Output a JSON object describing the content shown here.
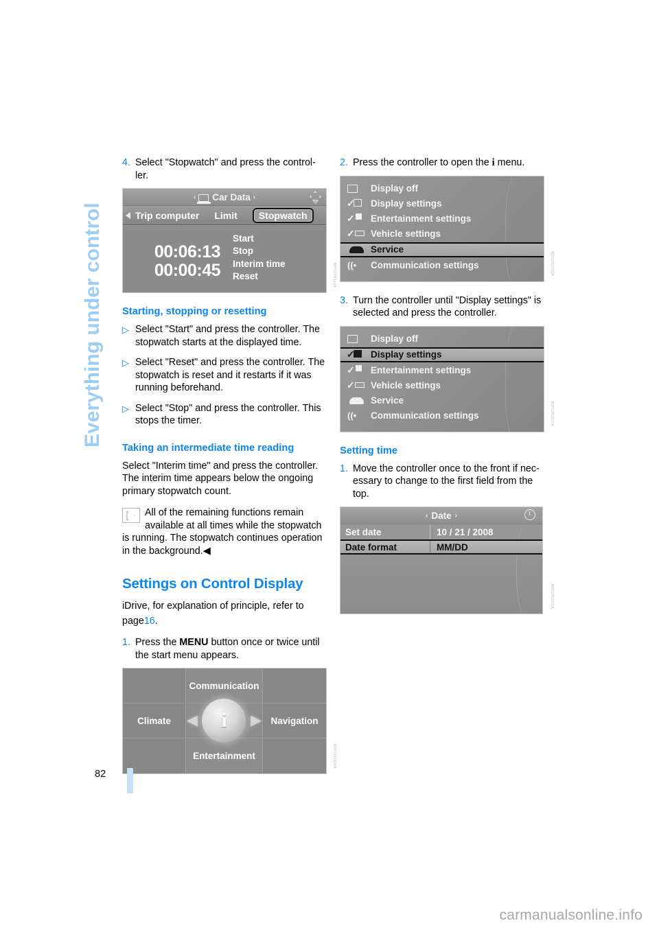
{
  "chapter_title": "Everything under control",
  "page_number": "82",
  "watermark": "carmanualsonline.info",
  "left_column": {
    "step4": {
      "num": "4.",
      "text": "Select \"Stopwatch\" and press the control-ler."
    },
    "stopwatch_screen": {
      "title": "Car Data",
      "arrow_left": "‹",
      "arrow_right": "›",
      "tabs": [
        "Trip computer",
        "Limit",
        "Stopwatch"
      ],
      "selected_tab": "Stopwatch",
      "primary_time": "00:06:13",
      "interim_time": "00:00:45",
      "actions": [
        "Start",
        "Stop",
        "Interim time",
        "Reset"
      ],
      "fig_code": "MPI0248101A"
    },
    "heading_start_stop": "Starting, stopping or resetting",
    "bullets": [
      "Select \"Start\" and press the controller. The stopwatch starts at the displayed time.",
      "Select \"Reset\" and press the controller. The stopwatch is reset and it restarts if it was running beforehand.",
      "Select \"Stop\" and press the controller. This stops the timer."
    ],
    "heading_interim": "Taking an intermediate time reading",
    "interim_para": "Select \"Interim time\" and press the controller. The interim time appears below the ongoing primary stopwatch count.",
    "note_text": "All of the remaining functions remain available at all times while the stopwatch is running. The stopwatch continues operation in the background.",
    "note_endmark": "◀",
    "heading_settings": "Settings on Control Display",
    "idrive_para_1": "iDrive, for explanation of principle, refer to",
    "idrive_para_2_pre": "page",
    "idrive_page_ref": "16",
    "idrive_para_2_post": ".",
    "step1": {
      "num": "1.",
      "pre": "Press the ",
      "kbd": "MENU",
      "post": " button once or twice until the start menu appears."
    },
    "start_menu_screen": {
      "top": "Communication",
      "left": "Climate",
      "right": "Navigation",
      "bottom": "Entertainment",
      "center_icon": "i",
      "fig_code": "MPI0252901A"
    }
  },
  "right_column": {
    "step2": {
      "num": "2.",
      "pre": "Press the controller to open the ",
      "icon": "i",
      "post": " menu."
    },
    "imenu_screen_1": {
      "items": [
        {
          "label": "Display off",
          "icon": "display-off-icon",
          "selected": false
        },
        {
          "label": "Display settings",
          "icon": "display-settings-icon",
          "selected": false
        },
        {
          "label": "Entertainment settings",
          "icon": "entertainment-settings-icon",
          "selected": false
        },
        {
          "label": "Vehicle settings",
          "icon": "vehicle-settings-icon",
          "selected": false
        },
        {
          "label": "Service",
          "icon": "service-car-icon",
          "selected": true
        },
        {
          "label": "Communication settings",
          "icon": "communication-icon",
          "selected": false
        }
      ],
      "fig_code": "MPI0252701A"
    },
    "step3": {
      "num": "3.",
      "text": "Turn the controller until \"Display settings\" is selected and press the controller."
    },
    "imenu_screen_2": {
      "items": [
        {
          "label": "Display off",
          "icon": "display-off-icon",
          "selected": false
        },
        {
          "label": "Display settings",
          "icon": "display-settings-icon",
          "selected": true
        },
        {
          "label": "Entertainment settings",
          "icon": "entertainment-settings-icon",
          "selected": false
        },
        {
          "label": "Vehicle settings",
          "icon": "vehicle-settings-icon",
          "selected": false
        },
        {
          "label": "Service",
          "icon": "service-car-icon",
          "selected": false
        },
        {
          "label": "Communication settings",
          "icon": "communication-icon",
          "selected": false
        }
      ],
      "fig_code": "MPI0252801A"
    },
    "heading_setting_time": "Setting time",
    "step1": {
      "num": "1.",
      "text": "Move the controller once to the front if nec-essary to change to the first field from the top."
    },
    "date_screen": {
      "title": "Date",
      "arrow_left": "‹",
      "arrow_right": "›",
      "rows": [
        {
          "key": "Set date",
          "value": "10 / 21 / 2008",
          "selected": false
        },
        {
          "key": "Date format",
          "value": "MM/DD",
          "selected": true
        }
      ],
      "fig_code": "MPI0252601A"
    }
  }
}
